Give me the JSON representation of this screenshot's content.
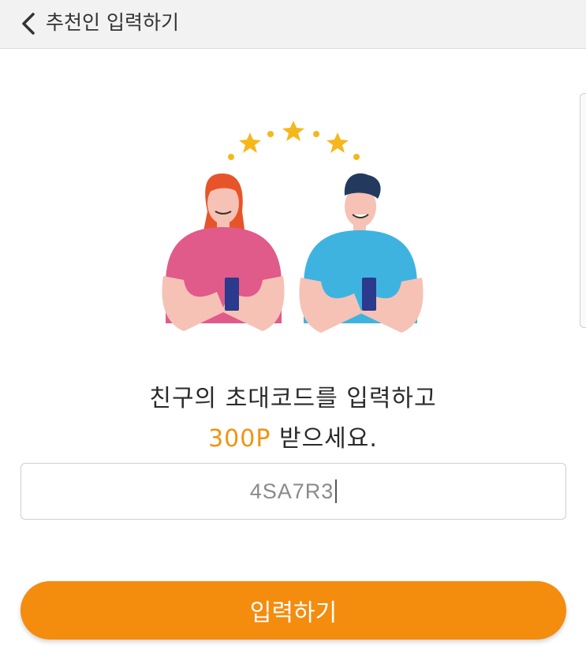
{
  "header": {
    "title": "추천인 입력하기",
    "back_icon": "chevron-left-icon"
  },
  "message": {
    "line1": "친구의 초대코드를 입력하고",
    "points": "300P",
    "line2_rest": " 받으세요."
  },
  "code_input": {
    "value": "4SA7R3"
  },
  "submit": {
    "label": "입력하기"
  },
  "colors": {
    "accent": "#f48c0e",
    "highlight": "#f0940f",
    "woman_shirt": "#e05a8a",
    "man_shirt": "#3fb3e0",
    "star": "#f5b81c"
  }
}
